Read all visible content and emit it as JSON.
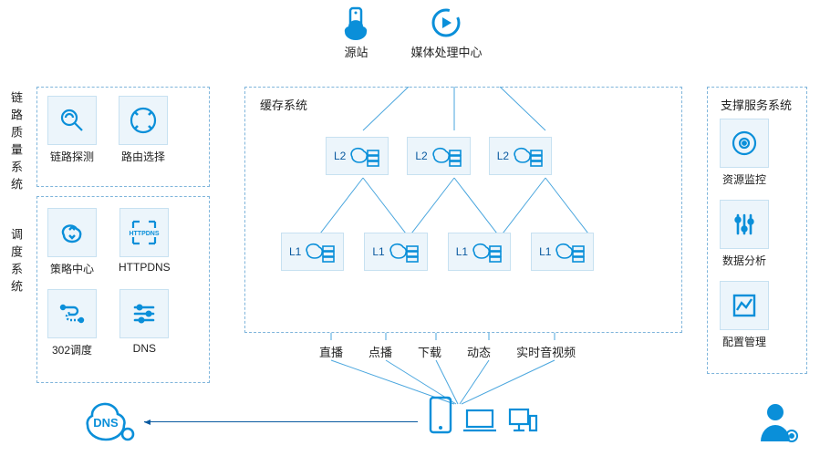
{
  "top": {
    "origin": "源站",
    "media_center": "媒体处理中心"
  },
  "left": {
    "quality_title": "链路质量系统",
    "schedule_title": "调度系统",
    "link_probe": "链路探测",
    "route_select": "路由选择",
    "policy_center": "策略中心",
    "httpdns": "HTTPDNS",
    "redirect302": "302调度",
    "dns": "DNS"
  },
  "center": {
    "title": "缓存系统",
    "l2": "L2",
    "l1": "L1"
  },
  "delivery": {
    "live": "直播",
    "vod": "点播",
    "download": "下载",
    "dynamic": "动态",
    "rtav": "实时音视频"
  },
  "right": {
    "title": "支撑服务系统",
    "monitor": "资源监控",
    "analytics": "数据分析",
    "config": "配置管理"
  },
  "dns_label": "DNS",
  "accent": "#0a8fd9"
}
